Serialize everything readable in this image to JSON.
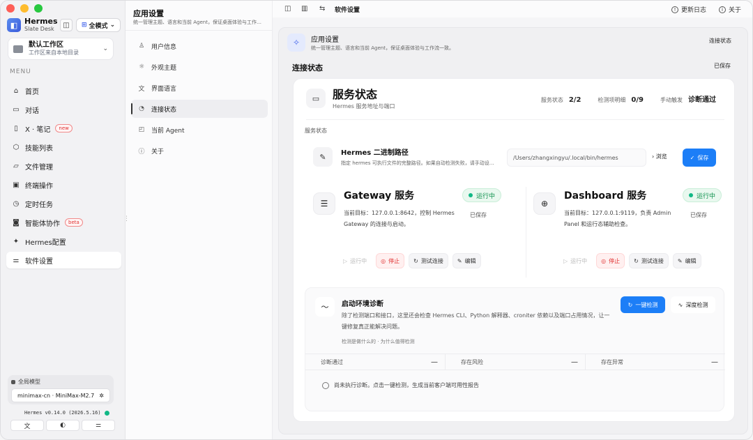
{
  "sidebar": {
    "brand_name": "Hermes",
    "brand_sub": "Slate Desk",
    "mode_label": "全模式",
    "workspace_name": "默认工作区",
    "workspace_sub": "工作区来自本地目录",
    "menu_label": "MENU",
    "items": [
      {
        "label": "首页",
        "icon": "home-icon"
      },
      {
        "label": "对话",
        "icon": "chat-icon"
      },
      {
        "label": "X · 笔记",
        "icon": "notebook-icon",
        "badge": "new"
      },
      {
        "label": "技能列表",
        "icon": "cube-icon"
      },
      {
        "label": "文件管理",
        "icon": "folder-icon"
      },
      {
        "label": "终端操作",
        "icon": "terminal-icon"
      },
      {
        "label": "定时任务",
        "icon": "clock-icon"
      },
      {
        "label": "智能体协作",
        "icon": "robot-icon",
        "badge": "beta"
      },
      {
        "label": "Hermes配置",
        "icon": "sparkle-icon"
      },
      {
        "label": "软件设置",
        "icon": "sliders-icon",
        "active": true
      }
    ],
    "model_label": "全局模型",
    "model_value": "minimax-cn · MiniMax-M2.7",
    "version": "Hermes v0.14.0 (2026.5.16)"
  },
  "settings_nav": {
    "title": "应用设置",
    "desc": "统一管理主题、语言和当前 Agent，保证桌面体验与工作流一致。",
    "items": [
      {
        "label": "用户信息",
        "icon": "user-icon"
      },
      {
        "label": "外观主题",
        "icon": "sun-icon"
      },
      {
        "label": "界面语言",
        "icon": "translate-icon"
      },
      {
        "label": "连接状态",
        "icon": "status-icon",
        "active": true
      },
      {
        "label": "当前 Agent",
        "icon": "agent-icon"
      },
      {
        "label": "关于",
        "icon": "info-icon"
      }
    ]
  },
  "topbar": {
    "title": "软件设置",
    "changelog": "更新日志",
    "about": "关于"
  },
  "panel": {
    "title": "应用设置",
    "desc": "统一管理主题、语言和当前 Agent，保证桌面体验与工作流一致。",
    "status_button": "连接状态",
    "section_title": "连接状态",
    "saved_pill": "已保存"
  },
  "service": {
    "title": "服务状态",
    "subtitle": "Hermes 服务地址与端口",
    "stats": [
      {
        "label": "服务状态",
        "value": "2/2"
      },
      {
        "label": "检测项明细",
        "value": "0/9"
      },
      {
        "label": "手动触发",
        "value": "诊断通过"
      }
    ],
    "sub_label": "服务状态",
    "path": {
      "title": "Hermes 二进制路径",
      "desc": "指定 hermes 可执行文件的完整路径。如果自动检测失败，请手动设置。",
      "value": "/Users/zhangxingyu/.local/bin/hermes",
      "browse": "浏览",
      "save": "保存"
    },
    "gateway": {
      "name": "Gateway 服务",
      "desc": "当前目标：127.0.0.1:8642，控制 Hermes Gateway 的连接与启动。",
      "status": "运行中",
      "saved": "已保存",
      "actions": {
        "running": "运行中",
        "stop": "停止",
        "test": "测试连接",
        "edit": "编辑"
      }
    },
    "dashboard": {
      "name": "Dashboard 服务",
      "desc": "当前目标：127.0.0.1:9119，负责 Admin Panel 和运行态辅助检查。",
      "status": "运行中",
      "saved": "已保存",
      "actions": {
        "running": "运行中",
        "stop": "停止",
        "test": "测试连接",
        "edit": "编辑"
      }
    }
  },
  "diagnostics": {
    "title": "启动环境诊断",
    "desc": "除了检测端口和接口，这里还会检查 Hermes CLI、Python 解释器、croniter 依赖以及端口占用情况，让一键修复真正能解决问题。",
    "note": "检测是做什么的 · 为什么值得检测",
    "primary_btn": "一键检测",
    "ghost_btn": "深度检测",
    "metrics": [
      {
        "label": "诊断通过",
        "value": "—"
      },
      {
        "label": "存在风险",
        "value": "—"
      },
      {
        "label": "存在异常",
        "value": "—"
      }
    ],
    "empty": "尚未执行诊断。点击一键检测，生成当前客户端可用性报告"
  },
  "colors": {
    "accent": "#1c7ef7",
    "success": "#12b886",
    "danger": "#e03131"
  }
}
